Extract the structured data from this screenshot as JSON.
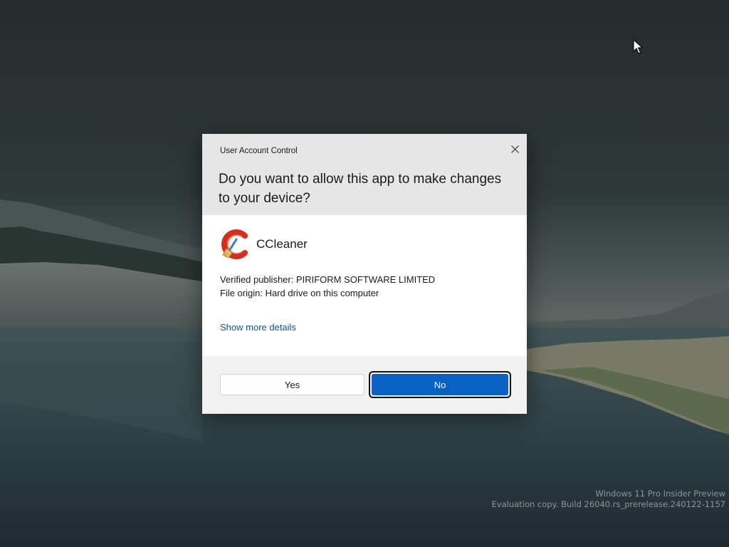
{
  "dialog": {
    "title": "User Account Control",
    "question": "Do you want to allow this app to make changes to your device?",
    "app_name": "CCleaner",
    "app_icon": "ccleaner-icon",
    "publisher": "Verified publisher: PIRIFORM SOFTWARE LIMITED",
    "origin": "File origin: Hard drive on this computer",
    "details_link": "Show more details",
    "yes_label": "Yes",
    "no_label": "No",
    "close_icon": "close-icon",
    "accent_color": "#0a61c4"
  },
  "watermark": {
    "line1": "Windows 11 Pro Insider Preview",
    "line2": "Evaluation copy. Build 26040.rs_prerelease.240122-1157"
  }
}
